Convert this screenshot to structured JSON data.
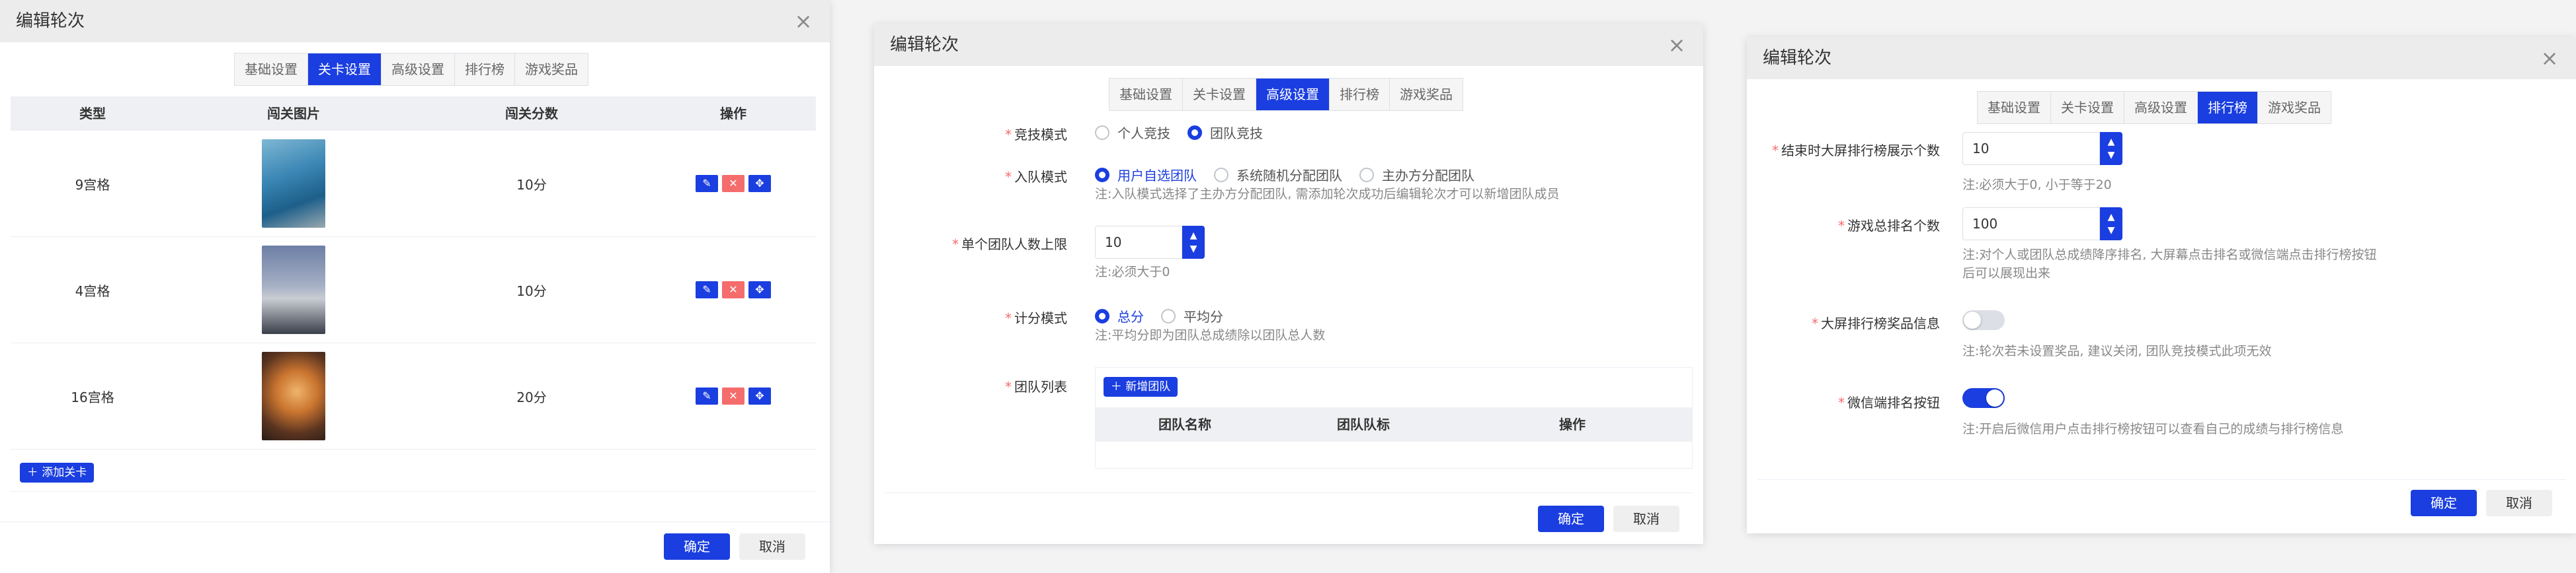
{
  "dialog1": {
    "title": "编辑轮次",
    "close": "×",
    "tabs": [
      "基础设置",
      "关卡设置",
      "高级设置",
      "排行榜",
      "游戏奖品"
    ],
    "active_tab": "关卡设置",
    "table": {
      "headers": [
        "类型",
        "闯关图片",
        "闯关分数",
        "操作"
      ],
      "rows": [
        {
          "type": "9宫格",
          "image": "blue-car-photo",
          "score": "10分"
        },
        {
          "type": "4宫格",
          "image": "silver-car-photo",
          "score": "10分"
        },
        {
          "type": "16宫格",
          "image": "gold-car-photo",
          "score": "20分"
        }
      ],
      "op_icons": [
        "edit-icon",
        "delete-icon",
        "move-icon"
      ]
    },
    "add_level": "＋ 添加关卡",
    "confirm": "确定",
    "cancel": "取消"
  },
  "dialog2": {
    "title": "编辑轮次",
    "close": "×",
    "tabs": [
      "基础设置",
      "关卡设置",
      "高级设置",
      "排行榜",
      "游戏奖品"
    ],
    "active_tab": "高级设置",
    "competition_mode": {
      "label": "竞技模式",
      "options": [
        "个人竞技",
        "团队竞技"
      ],
      "selected": "团队竞技"
    },
    "join_mode": {
      "label": "入队模式",
      "options": [
        "用户自选团队",
        "系统随机分配团队",
        "主办方分配团队"
      ],
      "selected": "用户自选团队",
      "note": "注:入队模式选择了主办方分配团队, 需添加轮次成功后编辑轮次才可以新增团队成员"
    },
    "team_limit": {
      "label": "单个团队人数上限",
      "value": "10",
      "note": "注:必须大于0"
    },
    "score_mode": {
      "label": "计分模式",
      "options": [
        "总分",
        "平均分"
      ],
      "selected": "总分",
      "note": "注:平均分即为团队总成绩除以团队总人数"
    },
    "team_list": {
      "label": "团队列表",
      "add_button": "＋ 新增团队",
      "headers": [
        "团队名称",
        "团队队标",
        "操作"
      ]
    },
    "confirm": "确定",
    "cancel": "取消"
  },
  "dialog3": {
    "title": "编辑轮次",
    "close": "×",
    "tabs": [
      "基础设置",
      "关卡设置",
      "高级设置",
      "排行榜",
      "游戏奖品"
    ],
    "active_tab": "排行榜",
    "screen_count": {
      "label": "结束时大屏排行榜展示个数",
      "value": "10",
      "note": "注:必须大于0, 小于等于20"
    },
    "total_rank": {
      "label": "游戏总排名个数",
      "value": "100",
      "note": "注:对个人或团队总成绩降序排名, 大屏幕点击排名或微信端点击排行榜按钮后可以展现出来"
    },
    "prize_info": {
      "label": "大屏排行榜奖品信息",
      "enabled": false,
      "note": "注:轮次若未设置奖品, 建议关闭, 团队竞技模式此项无效"
    },
    "wechat_button": {
      "label": "微信端排名按钮",
      "enabled": true,
      "note": "注:开启后微信用户点击排行榜按钮可以查看自己的成绩与排行榜信息"
    },
    "confirm": "确定",
    "cancel": "取消"
  },
  "colors": {
    "primary": "#1a3ee0",
    "danger": "#f56c6c",
    "header_bg": "#ececec"
  }
}
